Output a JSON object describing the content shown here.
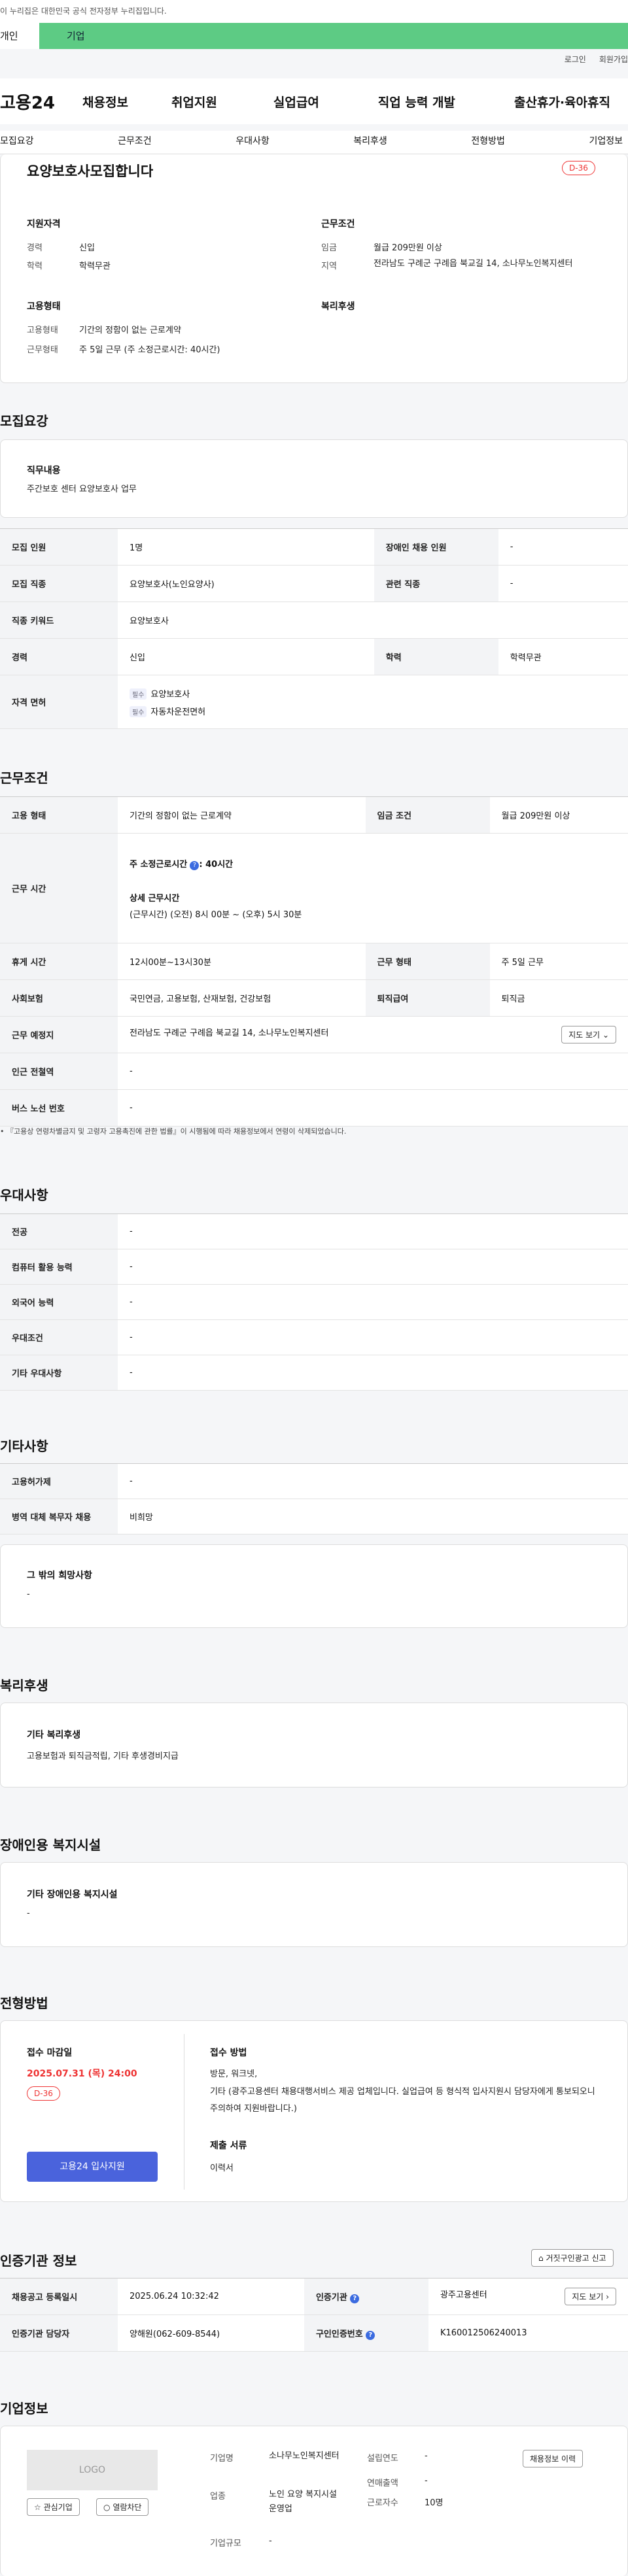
{
  "top_note": "이 누리집은 대한민국 공식 전자정부 누리집입니다.",
  "tabs": [
    "개인",
    "기업"
  ],
  "util": [
    "로그인",
    "회원가입"
  ],
  "gnb": {
    "logo": "고용24",
    "items": [
      "채용정보",
      "취업지원",
      "실업급여",
      "직업 능력 개발",
      "출산휴가·육아휴직"
    ]
  },
  "subnav": [
    "모집요강",
    "근무조건",
    "우대사항",
    "복리후생",
    "전형방법",
    "기업정보"
  ],
  "job": {
    "title": "요양보호사모집합니다",
    "dday": "D-36",
    "qual_title": "지원자격",
    "career_l": "경력",
    "career_v": "신입",
    "edu_l": "학력",
    "edu_v": "학력무관",
    "cond_title": "근무조건",
    "wage_l": "임금",
    "wage_v": "월급 209만원 이상",
    "area_l": "지역",
    "area_v": "전라남도 구례군 구례읍 북교길 14, 소나무노인복지센터",
    "emp_title": "고용형태",
    "emp_l": "고용형태",
    "emp_v": "기간의 정함이 없는 근로계약",
    "work_l": "근무형태",
    "work_v": "주 5일 근무 (주 소정근로시간: 40시간)",
    "welfare_title": "복리후생"
  },
  "recruit": {
    "title": "모집요강",
    "duty_title": "직무내용",
    "duty": "주간보호 센터  요양보호사 업무",
    "rows": [
      [
        "모집 인원",
        "1명",
        "장애인 채용 인원",
        "-"
      ],
      [
        "모집 직종",
        "요양보호사(노인요양사)",
        "관련 직종",
        "-"
      ],
      [
        "직종 키워드",
        "요양보호사"
      ],
      [
        "경력",
        "신입",
        "학력",
        "학력무관"
      ]
    ],
    "license_l": "자격 면허",
    "lic_tag": "필수",
    "lic1": "요양보호사",
    "lic2": "자동차운전면허"
  },
  "cond": {
    "title": "근무조건",
    "emp_l": "고용 형태",
    "emp_v": "기간의 정함이 없는 근로계약",
    "wage_l": "임금 조건",
    "wage_v": "월급 209만원 이상",
    "time_l": "근무 시간",
    "week_l": "주 소정근로시간",
    "week_v": ": 40시간",
    "detail_l": "상세 근무시간",
    "detail_v1": "(근무시간) (오전) 8시 00분 ~ (오후) 5시 30분",
    "rest_l": "휴게 시간",
    "rest_v": "12시00분~13시30분",
    "wtype_l": "근무 형태",
    "wtype_v": "주 5일 근무",
    "ins_l": "사회보험",
    "ins_v": "국민연금, 고용보험, 산재보험, 건강보험",
    "ret_l": "퇴직급여",
    "ret_v": "퇴직금",
    "place_l": "근무 예정지",
    "place_v": "전라남도 구례군 구례읍 북교길 14, 소나무노인복지센터",
    "map_btn": "지도 보기",
    "sub_l": "인근 전철역",
    "sub_v": "-",
    "bus_l": "버스 노선 번호",
    "bus_v": "-",
    "note": "• 『고용상 연령차별금지 및 고령자 고용촉진에 관한 법률』이 시행됨에 따라 채용정보에서 연령이 삭제되었습니다."
  },
  "pref": {
    "title": "우대사항",
    "rows": [
      [
        "전공",
        "-"
      ],
      [
        "컴퓨터 활용 능력",
        "-"
      ],
      [
        "외국어 능력",
        "-"
      ],
      [
        "우대조건",
        "-"
      ],
      [
        "기타 우대사항",
        "-"
      ]
    ]
  },
  "etc": {
    "title": "기타사항",
    "rows": [
      [
        "고용허가제",
        "-"
      ],
      [
        "병역 대체 복무자 채용",
        "비희망"
      ]
    ],
    "hope_title": "그 밖의 희망사항",
    "hope_v": "-"
  },
  "welfare": {
    "title": "복리후생",
    "sub": "기타 복리후생",
    "v": "고용보험과 퇴직금적립, 기타 후생경비지급"
  },
  "disab": {
    "title": "장애인용 복지시설",
    "sub": "기타 장애인용 복지시설",
    "v": "-"
  },
  "apply": {
    "title": "전형방법",
    "deadline_l": "접수 마감일",
    "deadline_v": "2025.07.31 (목) 24:00",
    "dday": "D-36",
    "apply_btn": "고용24 입사지원",
    "method_l": "접수 방법",
    "method_v1": "방문, 워크넷,",
    "method_v2": "기타 (광주고용센터 채용대행서비스 제공 업체입니다. 실업급여 등 형식적 입사지원시 담당자에게 통보되오니 주의하여 지원바랍니다.)",
    "doc_l": "제출 서류",
    "doc_v": "이력서"
  },
  "cert": {
    "title": "인증기관 정보",
    "report_btn": "거짓구인광고 신고",
    "reg_l": "채용공고 등록일시",
    "reg_v": "2025.06.24 10:32:42",
    "org_l": "인증기관",
    "org_v": "광주고용센터",
    "map_btn": "지도 보기",
    "mgr_l": "인증기관 담당자",
    "mgr_v": "양해원(062-609-8544)",
    "num_l": "구인인증번호",
    "num_v": "K160012506240013"
  },
  "company": {
    "title": "기업정보",
    "logo": "LOGO",
    "fav_btn": "관심기업",
    "block_btn": "열람차단",
    "name_l": "기업명",
    "name_v": "소나무노인복지센터",
    "year_l": "설립연도",
    "year_v": "-",
    "info_btn": "채용정보 이력",
    "sales_l": "연매출액",
    "sales_v": "-",
    "ind_l": "업종",
    "ind_v": "노인 요양 복지시설 운영업",
    "emp_l": "근로자수",
    "emp_v": "10명",
    "size_l": "기업규모",
    "size_v": "-"
  }
}
